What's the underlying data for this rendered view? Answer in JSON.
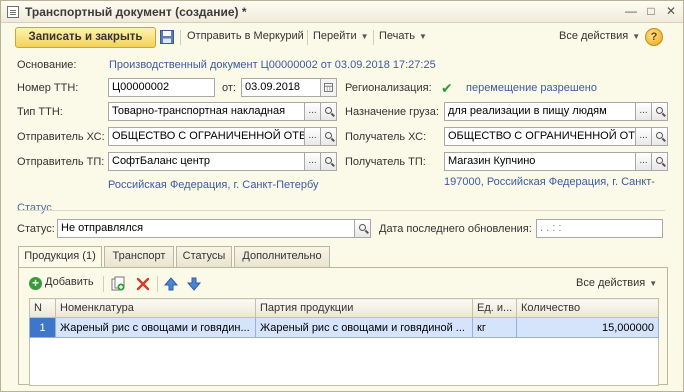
{
  "window": {
    "title": "Транспортный документ (создание) *",
    "controls": [
      "—",
      "□",
      "✕"
    ]
  },
  "toolbar": {
    "save_close": "Записать и закрыть",
    "send_mercury": "Отправить в Меркурий",
    "goto": "Перейти",
    "print": "Печать",
    "all_actions": "Все действия",
    "help": "?"
  },
  "header": {
    "basis_label": "Основание:",
    "basis_link": "Производственный документ Ц00000002 от 03.09.2018 17:27:25"
  },
  "form": {
    "ttn_number_label": "Номер ТТН:",
    "ttn_number": "Ц00000002",
    "date_label": "от:",
    "date": "03.09.2018",
    "ttn_type_label": "Тип ТТН:",
    "ttn_type": "Товарно-транспортная накладная",
    "sender_hs_label": "Отправитель ХС:",
    "sender_hs": "ОБЩЕСТВО С ОГРАНИЧЕННОЙ ОТВЕ",
    "sender_tp_label": "Отправитель ТП:",
    "sender_tp": "СофтБаланс центр",
    "sender_address": "Российская Федерация, г. Санкт-Петербу",
    "regionalization_label": "Регионализация:",
    "regionalization_value": "перемещение разрешено",
    "cargo_purpose_label": "Назначение груза:",
    "cargo_purpose": "для реализации в пищу людям",
    "receiver_hs_label": "Получатель ХС:",
    "receiver_hs": "ОБЩЕСТВО С ОГРАНИЧЕННОЙ ОТІ",
    "receiver_tp_label": "Получатель ТП:",
    "receiver_tp": "Магазин Купчино",
    "receiver_address": "197000, Российская Федерация, г. Санкт-"
  },
  "status_group": {
    "title": "Статус",
    "status_label": "Статус:",
    "status_value": "Не отправлялся",
    "last_update_label": "Дата последнего обновления:",
    "last_update_value": " .  .        :  :"
  },
  "tabs": [
    "Продукция (1)",
    "Транспорт",
    "Статусы",
    "Дополнительно"
  ],
  "products": {
    "add_label": "Добавить",
    "all_actions": "Все действия",
    "columns": [
      "N",
      "Номенклатура",
      "Партия продукции",
      "Ед. и...",
      "Количество"
    ],
    "rows": [
      {
        "n": "1",
        "nomenclature": "Жареный рис с овощами и говядин...",
        "batch": "Жареный рис с овощами и говядиной ...",
        "unit": "кг",
        "qty": "15,000000"
      }
    ]
  },
  "colors": {
    "background": "#fbf9e8",
    "primary_button": "#f3d25a",
    "link": "#3c5aa6",
    "selected_row": "#d6e4fb",
    "check": "#2e9a35"
  }
}
